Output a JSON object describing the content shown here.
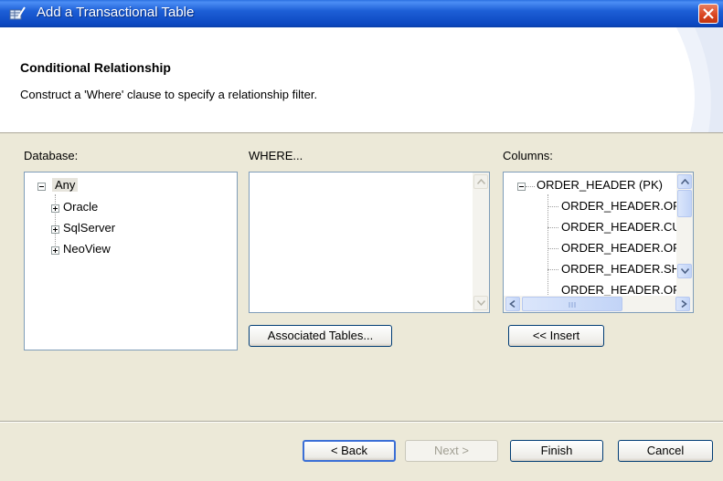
{
  "window": {
    "title": "Add a Transactional Table",
    "close_icon": "close-icon"
  },
  "banner": {
    "heading": "Conditional Relationship",
    "description": "Construct a 'Where' clause to specify a relationship filter."
  },
  "database": {
    "label": "Database:",
    "root": "Any",
    "children": [
      "Oracle",
      "SqlServer",
      "NeoView"
    ]
  },
  "where": {
    "label": "WHERE...",
    "value": "",
    "associated_button": "Associated Tables..."
  },
  "columns": {
    "label": "Columns:",
    "root": "ORDER_HEADER (PK)",
    "items": [
      "ORDER_HEADER.OR",
      "ORDER_HEADER.CU",
      "ORDER_HEADER.OR",
      "ORDER_HEADER.SH",
      "ORDER_HEADER.OR"
    ],
    "insert_button": "<< Insert"
  },
  "footer": {
    "back": "< Back",
    "next": "Next >",
    "finish": "Finish",
    "cancel": "Cancel"
  },
  "colors": {
    "title_bar": "#0c47c0",
    "dialog_bg": "#ece9d8",
    "panel_border": "#7f9db9",
    "close_button": "#d9441f"
  }
}
